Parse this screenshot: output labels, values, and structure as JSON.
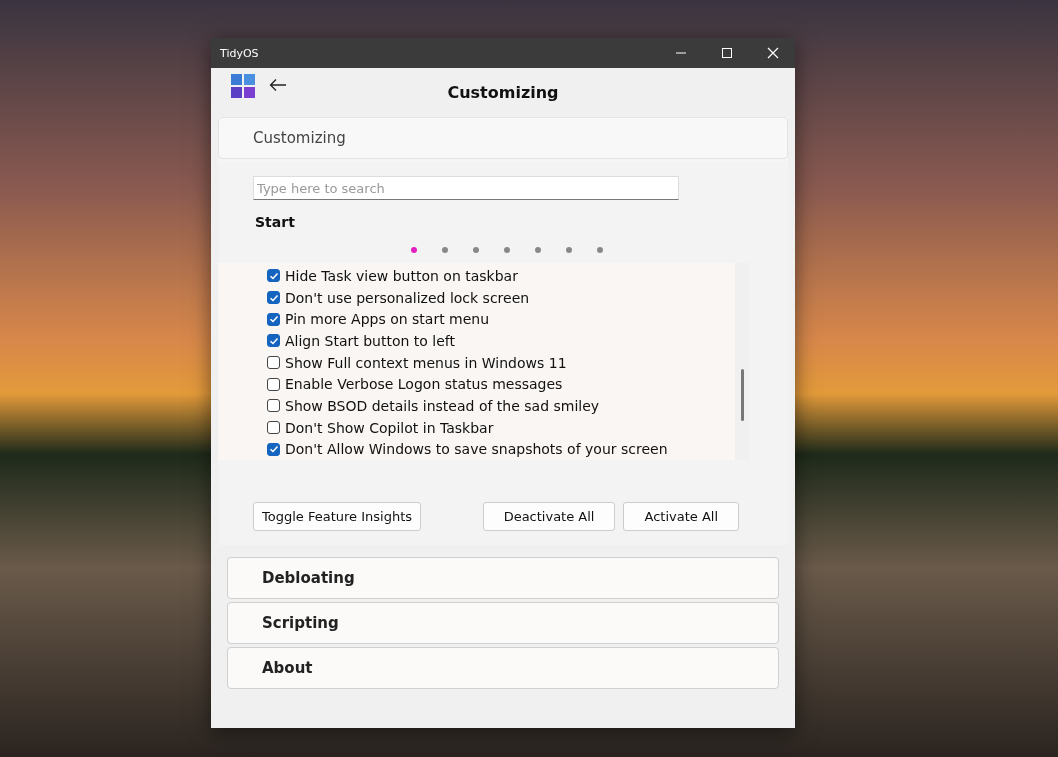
{
  "window": {
    "title": "TidyOS"
  },
  "header": {
    "title": "Customizing"
  },
  "expanders": [
    {
      "title": "Customizing",
      "expanded": true
    },
    {
      "title": "Debloating",
      "expanded": false
    },
    {
      "title": "Scripting",
      "expanded": false
    },
    {
      "title": "About",
      "expanded": false
    }
  ],
  "search": {
    "placeholder": "Type here to search"
  },
  "section": "Start",
  "pager": [
    {
      "selected": true
    },
    {
      "selected": false
    },
    {
      "selected": false
    },
    {
      "selected": false
    },
    {
      "selected": false
    },
    {
      "selected": false
    },
    {
      "selected": false
    }
  ],
  "options": [
    {
      "label": "Hide Task view button on taskbar",
      "checked": true
    },
    {
      "label": "Don't use personalized lock screen",
      "checked": true
    },
    {
      "label": "Pin more Apps on start menu",
      "checked": true
    },
    {
      "label": "Align Start button to left",
      "checked": true
    },
    {
      "label": "Show Full context menus in Windows 11",
      "checked": false
    },
    {
      "label": "Enable Verbose Logon status messages",
      "checked": false
    },
    {
      "label": "Show BSOD details instead of the sad smiley",
      "checked": false
    },
    {
      "label": "Don't Show Copilot in Taskbar",
      "checked": false
    },
    {
      "label": "Don't Allow Windows to save snapshots of your screen",
      "checked": true
    }
  ],
  "buttons": {
    "left": "Toggle Feature Insights",
    "right": [
      "Deactivate All",
      "Activate All"
    ]
  }
}
